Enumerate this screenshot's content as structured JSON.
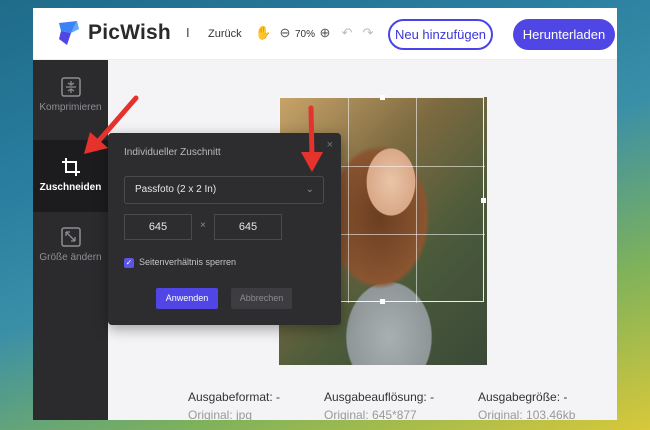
{
  "header": {
    "logo_text": "PicWish",
    "separator": "I",
    "back_label": "Zurück",
    "zoom_level": "70%",
    "add_button": "Neu hinzufügen",
    "download_button": "Herunterladen"
  },
  "sidebar": {
    "items": [
      {
        "label": "Komprimieren",
        "icon": "compress-icon",
        "active": false
      },
      {
        "label": "Zuschneiden",
        "icon": "crop-icon",
        "active": true
      },
      {
        "label": "Größe ändern",
        "icon": "resize-icon",
        "active": false
      }
    ]
  },
  "crop_panel": {
    "title": "Individueller Zuschnitt",
    "close": "×",
    "preset_value": "Passfoto (2 x 2 In)",
    "width_value": "645",
    "height_value": "645",
    "times_symbol": "×",
    "lock_ratio_label": "Seitenverhältnis sperren",
    "lock_ratio_checked": true,
    "apply_label": "Anwenden",
    "cancel_label": "Abbrechen"
  },
  "info": {
    "format_label": "Ausgabeformat: -",
    "format_original": "Original: jpg",
    "resolution_label": "Ausgabeauflösung: -",
    "resolution_original": "Original: 645*877",
    "size_label": "Ausgabegröße: -",
    "size_original": "Original: 103.46kb"
  },
  "colors": {
    "accent": "#4f46e5",
    "sidebar_bg": "#2b2b2e",
    "panel_bg": "#2d2d30",
    "annotation_arrow": "#e5322d"
  }
}
